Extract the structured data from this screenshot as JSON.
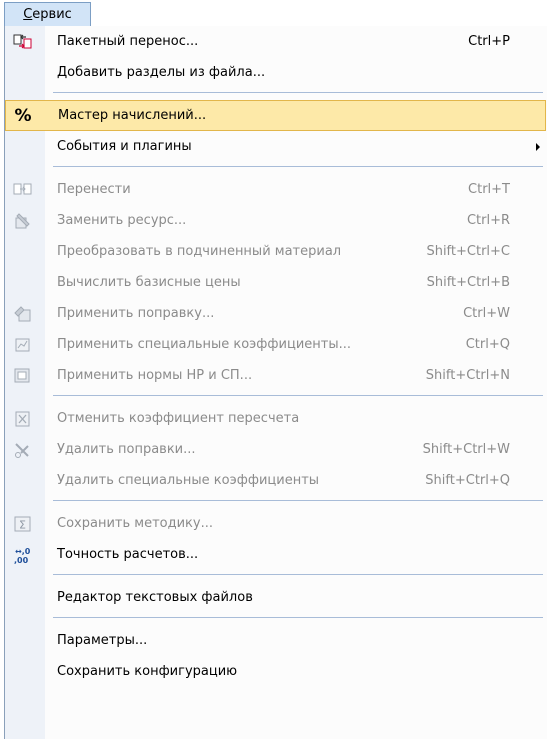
{
  "menubar": {
    "title_first": "С",
    "title_rest": "ервис"
  },
  "items": [
    {
      "label": "Пакетный перенос...",
      "shortcut": "Ctrl+P",
      "icon": "batch-transfer-icon",
      "glyph": "⇄"
    },
    {
      "label": "Добавить разделы из файла...",
      "shortcut": "",
      "icon": "",
      "glyph": ""
    },
    {
      "label": "Мастер начислений...",
      "shortcut": "",
      "icon": "percent-icon",
      "glyph": "%"
    },
    {
      "label": "События и плагины",
      "shortcut": "",
      "icon": "",
      "glyph": ""
    },
    {
      "label": "Перенести",
      "shortcut": "Ctrl+T",
      "icon": "transfer-icon",
      "glyph": "⇄"
    },
    {
      "label": "Заменить ресурс...",
      "shortcut": "Ctrl+R",
      "icon": "replace-resource-icon",
      "glyph": "✎"
    },
    {
      "label": "Преобразовать в подчиненный материал",
      "shortcut": "Shift+Ctrl+C",
      "icon": "",
      "glyph": ""
    },
    {
      "label": "Вычислить базисные цены",
      "shortcut": "Shift+Ctrl+B",
      "icon": "",
      "glyph": ""
    },
    {
      "label": "Применить поправку...",
      "shortcut": "Ctrl+W",
      "icon": "apply-correction-icon",
      "glyph": "⚙"
    },
    {
      "label": "Применить специальные коэффициенты...",
      "shortcut": "Ctrl+Q",
      "icon": "special-coefficients-icon",
      "glyph": "▦"
    },
    {
      "label": "Применить нормы НР и СП...",
      "shortcut": "Shift+Ctrl+N",
      "icon": "norms-icon",
      "glyph": "▤"
    },
    {
      "label": "Отменить коэффициент пересчета",
      "shortcut": "",
      "icon": "cancel-coefficient-icon",
      "glyph": "⊠"
    },
    {
      "label": "Удалить поправки...",
      "shortcut": "Shift+Ctrl+W",
      "icon": "delete-corrections-icon",
      "glyph": "✂"
    },
    {
      "label": "Удалить специальные коэффициенты",
      "shortcut": "Shift+Ctrl+Q",
      "icon": "",
      "glyph": ""
    },
    {
      "label": "Сохранить методику...",
      "shortcut": "",
      "icon": "sigma-icon",
      "glyph": "Σ"
    },
    {
      "label": "Точность расчетов...",
      "shortcut": "",
      "icon": "precision-icon",
      "glyph": "+,0"
    },
    {
      "label": "Редактор текстовых файлов",
      "shortcut": "",
      "icon": "",
      "glyph": ""
    },
    {
      "label": "Параметры...",
      "shortcut": "",
      "icon": "",
      "glyph": ""
    },
    {
      "label": "Сохранить конфигурацию",
      "shortcut": "",
      "icon": "",
      "glyph": ""
    }
  ]
}
